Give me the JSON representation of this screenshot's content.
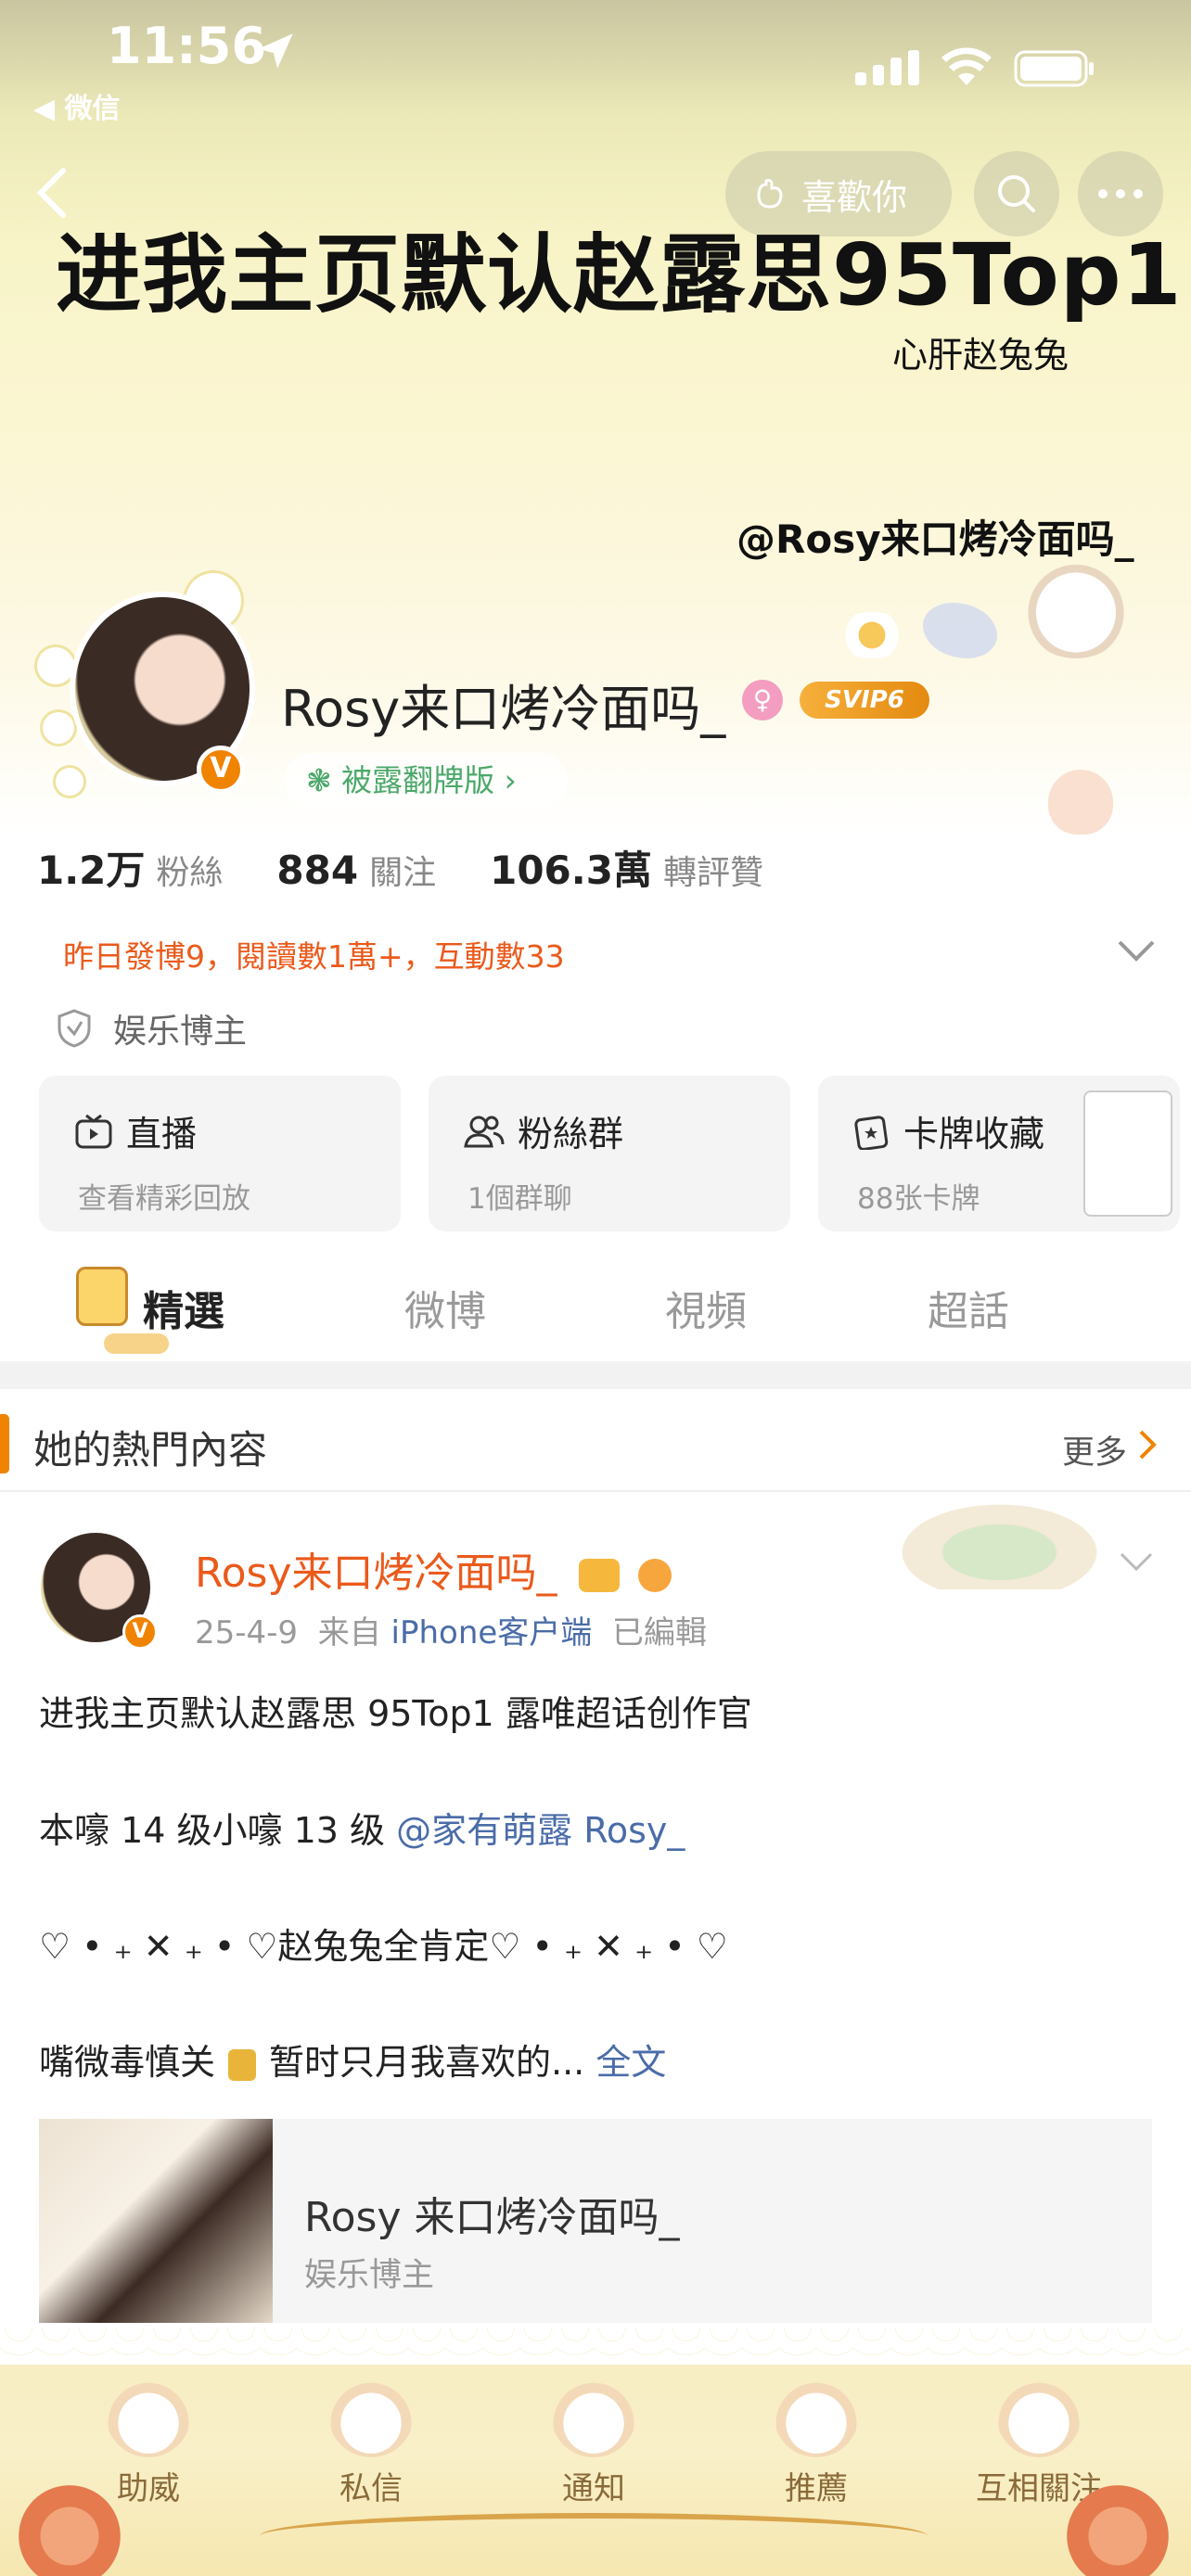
{
  "status_bar": {
    "time": "11:56",
    "back_app": "◀ 微信"
  },
  "nav": {
    "like_label": "喜歡你"
  },
  "banner": {
    "title": "进我主页默认赵露思95Top1",
    "subtitle": "心肝赵兔兔",
    "handle": "@Rosy来口烤冷面吗_"
  },
  "profile": {
    "username": "Rosy来口烤冷面吗_",
    "svip_label": "SVIP6",
    "verified_mark": "V",
    "subtitle_pill": "被露翻牌版 ›",
    "stats": [
      {
        "value": "1.2万",
        "label": "粉絲"
      },
      {
        "value": "884",
        "label": "關注"
      },
      {
        "value": "106.3萬",
        "label": "轉評贊"
      }
    ],
    "activity": "昨日發博9，閱讀數1萬+，互動數33",
    "verify_label": "娱乐博主"
  },
  "cards": [
    {
      "title": "直播",
      "sub": "查看精彩回放",
      "icon": "tv-icon"
    },
    {
      "title": "粉絲群",
      "sub": "1個群聊",
      "icon": "group-icon"
    },
    {
      "title": "卡牌收藏",
      "sub": "88张卡牌",
      "icon": "card-icon"
    }
  ],
  "tabs": [
    {
      "label": "精選",
      "active": true
    },
    {
      "label": "微博",
      "active": false
    },
    {
      "label": "視頻",
      "active": false
    },
    {
      "label": "超話",
      "active": false
    }
  ],
  "hot": {
    "title": "她的熱門內容",
    "more": "更多"
  },
  "post": {
    "author": "Rosy来口烤冷面吗_",
    "date": "25-4-9",
    "from_prefix": "来自",
    "source": "iPhone客户端",
    "edited": "已編輯",
    "line1": "进我主页默认赵露思 95Top1 露唯超话创作官",
    "line2_prefix": "本嚎 14 级小嚎 13 级 ",
    "line2_mention": "@家有萌露 Rosy_",
    "line3": "♡ • ₊ ✕ ₊ • ♡赵兔兔全肯定♡ • ₊ ✕ ₊ • ♡",
    "line4_a": "嘴微毒慎关",
    "line4_b": "暂时只月我喜欢的...",
    "line4_link": "全文",
    "share_name": "Rosy 来口烤冷面吗_",
    "share_sub": "娱乐博主"
  },
  "bottom_tabs": [
    "助威",
    "私信",
    "通知",
    "推薦",
    "互相關注"
  ],
  "colors": {
    "accent": "#f08300",
    "activity": "#ea5a1b",
    "link": "#4a6ca8",
    "green": "#4ca86a"
  }
}
